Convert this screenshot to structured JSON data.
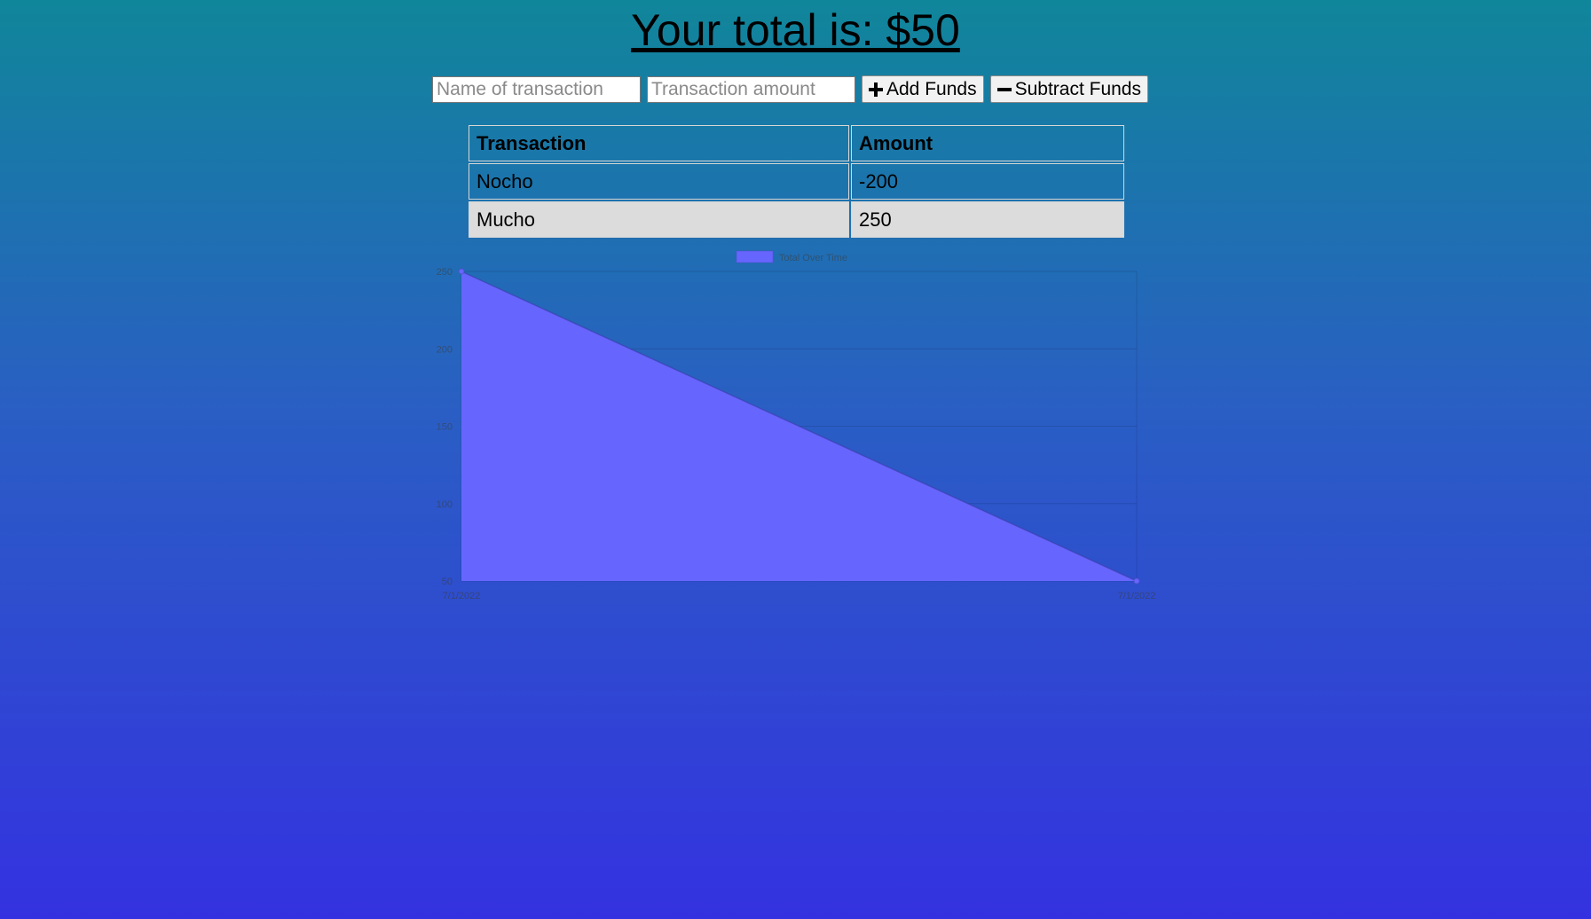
{
  "header": {
    "title": "Your total is: $50"
  },
  "form": {
    "name_placeholder": "Name of transaction",
    "amount_placeholder": "Transaction amount",
    "add_label": "Add Funds",
    "subtract_label": "Subtract Funds",
    "add_icon": "plus-icon",
    "subtract_icon": "minus-icon"
  },
  "table": {
    "headers": [
      "Transaction",
      "Amount"
    ],
    "rows": [
      [
        "Nocho",
        "-200"
      ],
      [
        "Mucho",
        "250"
      ]
    ]
  },
  "chart_data": {
    "type": "area",
    "title": "",
    "xlabel": "",
    "ylabel": "",
    "categories": [
      "7/1/2022",
      "7/1/2022"
    ],
    "series": [
      {
        "name": "Total Over Time",
        "values": [
          250,
          50
        ],
        "color": "#6666ff"
      }
    ],
    "ylim": [
      50,
      250
    ],
    "yticks": [
      50,
      100,
      150,
      200,
      250
    ],
    "grid": true,
    "legend": "top"
  },
  "colors": {
    "area_fill": "#6666ff",
    "gradient_top": "#10869a",
    "gradient_bottom": "#3432e0"
  }
}
